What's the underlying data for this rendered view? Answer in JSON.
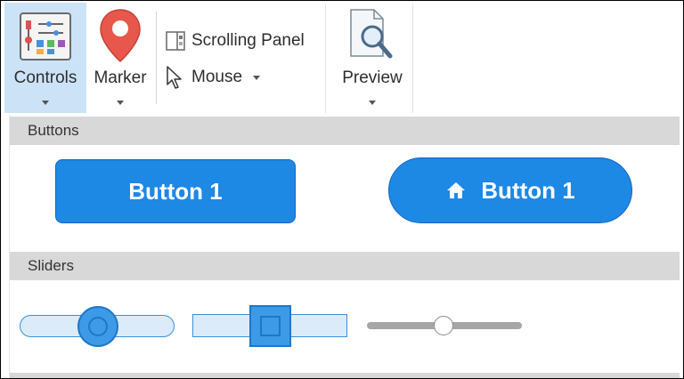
{
  "ribbon": {
    "controls": {
      "label": "Controls",
      "icon": "controls-icon"
    },
    "marker": {
      "label": "Marker",
      "icon": "map-pin-icon"
    },
    "scrolling_panel": {
      "label": "Scrolling Panel",
      "icon": "panel-icon"
    },
    "mouse": {
      "label": "Mouse",
      "icon": "cursor-icon"
    },
    "preview": {
      "label": "Preview",
      "icon": "magnifier-doc-icon"
    }
  },
  "gallery": {
    "buttons_header": "Buttons",
    "button1_label": "Button 1",
    "button2_label": "Button 1",
    "sliders_header": "Sliders"
  },
  "sliders": [
    {
      "style": "rounded-blue",
      "value_fraction": 0.52
    },
    {
      "style": "square-blue",
      "value_fraction": 0.48
    },
    {
      "style": "thin-gray",
      "value_fraction": 0.5
    }
  ],
  "colors": {
    "accent": "#1e88e5",
    "active_ribbon": "#cce3f7",
    "header_bg": "#d8d8d8",
    "marker_red": "#e8574b"
  }
}
